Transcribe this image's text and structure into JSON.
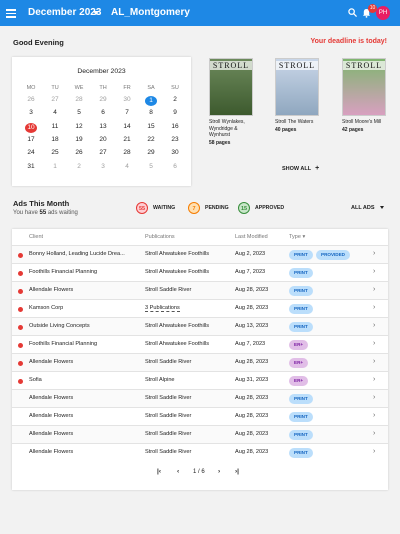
{
  "header": {
    "month": "December 2023",
    "user": "AL_Montgomery",
    "notifications": "10",
    "avatar": "PH"
  },
  "greeting": "Good Evening",
  "deadline": "Your deadline is today!",
  "calendar": {
    "title": "December 2023",
    "weekdays": [
      "MO",
      "TU",
      "WE",
      "TH",
      "FR",
      "SA",
      "SU"
    ],
    "weeks": [
      [
        "26",
        "27",
        "28",
        "29",
        "30",
        "1",
        "2"
      ],
      [
        "3",
        "4",
        "5",
        "6",
        "7",
        "8",
        "9"
      ],
      [
        "10",
        "11",
        "12",
        "13",
        "14",
        "15",
        "16"
      ],
      [
        "17",
        "18",
        "19",
        "20",
        "21",
        "22",
        "23"
      ],
      [
        "24",
        "25",
        "26",
        "27",
        "28",
        "29",
        "30"
      ],
      [
        "31",
        "1",
        "2",
        "3",
        "4",
        "5",
        "6"
      ]
    ]
  },
  "magazines": [
    {
      "logo": "STROLL",
      "name": "Stroll Wynlakes, Wyndridge & Wynhurst",
      "pages": "58 pages"
    },
    {
      "logo": "STROLL",
      "name": "Stroll The Waters",
      "pages": "40 pages"
    },
    {
      "logo": "STROLL",
      "name": "Stroll Moore's Mill",
      "pages": "42 pages"
    }
  ],
  "show_all": "SHOW ALL",
  "ads": {
    "title": "Ads This Month",
    "subtitle_pre": "You have",
    "subtitle_count": "55",
    "subtitle_post": "ads waiting",
    "stats": [
      {
        "count": "55",
        "label": "WAITING",
        "color": "#e53935",
        "bg": "#ffcdd2"
      },
      {
        "count": "7",
        "label": "PENDING",
        "color": "#f57c00",
        "bg": "#ffe0b2"
      },
      {
        "count": "15",
        "label": "APPROVED",
        "color": "#388e3c",
        "bg": "#c8e6c9"
      }
    ],
    "filter": "ALL ADS"
  },
  "table": {
    "headers": {
      "client": "Client",
      "publications": "Publications",
      "modified": "Last Modified",
      "type": "Type"
    },
    "rows": [
      {
        "dot": true,
        "client": "Bonny Holland, Leading Lucide Drea...",
        "pub": "Stroll Ahwatukee Foothills",
        "date": "Aug 2, 2023",
        "chips": [
          "PRINT",
          "PROVIDED"
        ]
      },
      {
        "dot": true,
        "client": "Foothills Financial Planning",
        "pub": "Stroll Ahwatukee Foothills",
        "date": "Aug 7, 2023",
        "chips": [
          "PRINT"
        ]
      },
      {
        "dot": true,
        "client": "Allendale Flowers",
        "pub": "Stroll Saddle River",
        "date": "Aug 28, 2023",
        "chips": [
          "PRINT"
        ]
      },
      {
        "dot": true,
        "client": "Kamson Corp",
        "pub": "3 Publications",
        "date": "Aug 28, 2023",
        "chips": [
          "PRINT"
        ]
      },
      {
        "dot": true,
        "client": "Outside Living Concepts",
        "pub": "Stroll Ahwatukee Foothills",
        "date": "Aug 13, 2023",
        "chips": [
          "PRINT"
        ]
      },
      {
        "dot": true,
        "client": "Foothills Financial Planning",
        "pub": "Stroll Ahwatukee Foothills",
        "date": "Aug 7, 2023",
        "chips": [
          "ER+"
        ]
      },
      {
        "dot": true,
        "client": "Allendale Flowers",
        "pub": "Stroll Saddle River",
        "date": "Aug 28, 2023",
        "chips": [
          "ER+"
        ]
      },
      {
        "dot": true,
        "client": "Sofia",
        "pub": "Stroll Alpine",
        "date": "Aug 31, 2023",
        "chips": [
          "ER+"
        ]
      },
      {
        "dot": false,
        "client": "Allendale Flowers",
        "pub": "Stroll Saddle River",
        "date": "Aug 28, 2023",
        "chips": [
          "PRINT"
        ]
      },
      {
        "dot": false,
        "client": "Allendale Flowers",
        "pub": "Stroll Saddle River",
        "date": "Aug 28, 2023",
        "chips": [
          "PRINT"
        ]
      },
      {
        "dot": false,
        "client": "Allendale Flowers",
        "pub": "Stroll Saddle River",
        "date": "Aug 28, 2023",
        "chips": [
          "PRINT"
        ]
      },
      {
        "dot": false,
        "client": "Allendale Flowers",
        "pub": "Stroll Saddle River",
        "date": "Aug 28, 2023",
        "chips": [
          "PRINT"
        ]
      }
    ]
  },
  "pagination": {
    "current": "1 / 6"
  }
}
